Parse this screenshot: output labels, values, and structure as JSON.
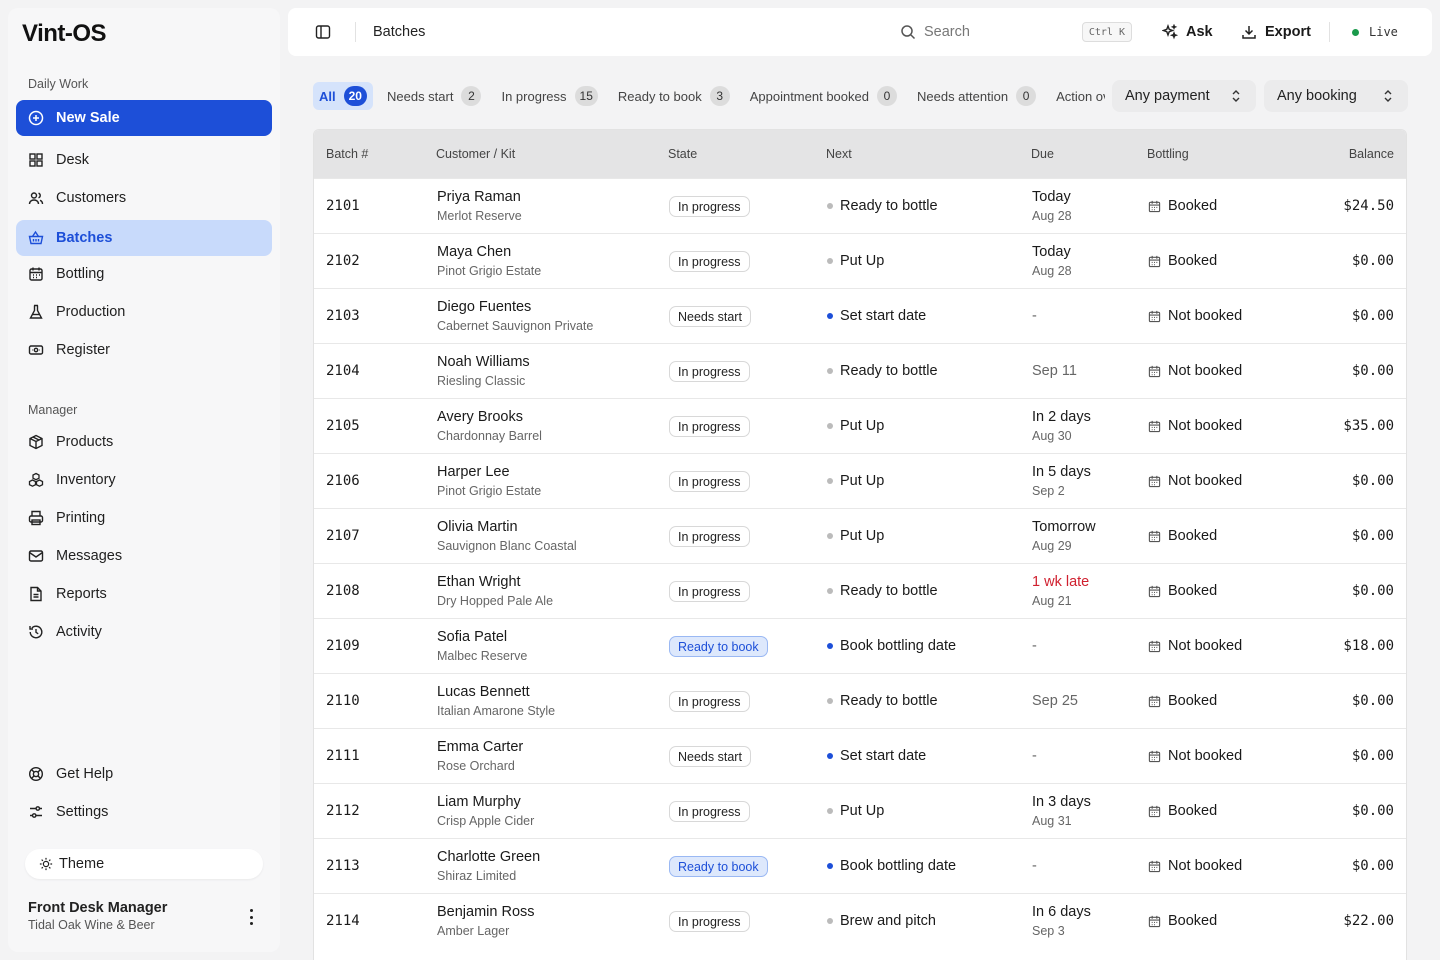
{
  "app": {
    "logo": "Vint-OS"
  },
  "sidebar": {
    "daily_work_label": "Daily Work",
    "new_sale": "New Sale",
    "daily": [
      {
        "label": "Desk",
        "icon": "grid-icon"
      },
      {
        "label": "Customers",
        "icon": "users-icon"
      },
      {
        "label": "Batches",
        "icon": "basket-icon"
      },
      {
        "label": "Bottling",
        "icon": "calendar-icon"
      },
      {
        "label": "Production",
        "icon": "flask-icon"
      },
      {
        "label": "Register",
        "icon": "cash-icon"
      }
    ],
    "manager_label": "Manager",
    "manager": [
      {
        "label": "Products",
        "icon": "box-icon"
      },
      {
        "label": "Inventory",
        "icon": "boxes-icon"
      },
      {
        "label": "Printing",
        "icon": "printer-icon"
      },
      {
        "label": "Messages",
        "icon": "mail-icon"
      },
      {
        "label": "Reports",
        "icon": "file-icon"
      },
      {
        "label": "Activity",
        "icon": "history-icon"
      }
    ],
    "footer": [
      {
        "label": "Get Help",
        "icon": "lifebuoy-icon"
      },
      {
        "label": "Settings",
        "icon": "sliders-icon"
      }
    ],
    "theme": "Theme",
    "user": {
      "name": "Front Desk Manager",
      "org": "Tidal Oak Wine & Beer"
    }
  },
  "header": {
    "title": "Batches",
    "search_placeholder": "Search",
    "shortcut": "Ctrl K",
    "ask": "Ask",
    "export": "Export",
    "live": "Live"
  },
  "filters": {
    "chips": [
      {
        "label": "All",
        "count": "20"
      },
      {
        "label": "Needs start",
        "count": "2"
      },
      {
        "label": "In progress",
        "count": "15"
      },
      {
        "label": "Ready to book",
        "count": "3"
      },
      {
        "label": "Appointment booked",
        "count": "0"
      },
      {
        "label": "Needs attention",
        "count": "0"
      },
      {
        "label": "Action overdue",
        "count": ""
      }
    ],
    "payment": "Any payment",
    "booking": "Any booking"
  },
  "table": {
    "columns": [
      "Batch #",
      "Customer / Kit",
      "State",
      "Next",
      "Due",
      "Bottling",
      "Balance"
    ],
    "rows": [
      {
        "id": "2101",
        "name": "Priya Raman",
        "kit": "Merlot Reserve",
        "state": "In progress",
        "next": "Ready to bottle",
        "due": "Today",
        "due_date": "Aug 28",
        "bottling": "Booked",
        "balance": "$24.50"
      },
      {
        "id": "2102",
        "name": "Maya Chen",
        "kit": "Pinot Grigio Estate",
        "state": "In progress",
        "next": "Put Up",
        "due": "Today",
        "due_date": "Aug 28",
        "bottling": "Booked",
        "balance": "$0.00"
      },
      {
        "id": "2103",
        "name": "Diego Fuentes",
        "kit": "Cabernet Sauvignon Private",
        "state": "Needs start",
        "next": "Set start date",
        "due": "-",
        "due_date": "",
        "bottling": "Not booked",
        "balance": "$0.00"
      },
      {
        "id": "2104",
        "name": "Noah Williams",
        "kit": "Riesling Classic",
        "state": "In progress",
        "next": "Ready to bottle",
        "due": "Sep 11",
        "due_date": "",
        "bottling": "Not booked",
        "balance": "$0.00"
      },
      {
        "id": "2105",
        "name": "Avery Brooks",
        "kit": "Chardonnay Barrel",
        "state": "In progress",
        "next": "Put Up",
        "due": "In 2 days",
        "due_date": "Aug 30",
        "bottling": "Not booked",
        "balance": "$35.00"
      },
      {
        "id": "2106",
        "name": "Harper Lee",
        "kit": "Pinot Grigio Estate",
        "state": "In progress",
        "next": "Put Up",
        "due": "In 5 days",
        "due_date": "Sep 2",
        "bottling": "Not booked",
        "balance": "$0.00"
      },
      {
        "id": "2107",
        "name": "Olivia Martin",
        "kit": "Sauvignon Blanc Coastal",
        "state": "In progress",
        "next": "Put Up",
        "due": "Tomorrow",
        "due_date": "Aug 29",
        "bottling": "Booked",
        "balance": "$0.00"
      },
      {
        "id": "2108",
        "name": "Ethan Wright",
        "kit": "Dry Hopped Pale Ale",
        "state": "In progress",
        "next": "Ready to bottle",
        "due": "1 wk late",
        "due_date": "Aug 21",
        "bottling": "Booked",
        "balance": "$0.00",
        "late": true
      },
      {
        "id": "2109",
        "name": "Sofia Patel",
        "kit": "Malbec Reserve",
        "state": "Ready to book",
        "next": "Book bottling date",
        "due": "-",
        "due_date": "",
        "bottling": "Not booked",
        "balance": "$18.00"
      },
      {
        "id": "2110",
        "name": "Lucas Bennett",
        "kit": "Italian Amarone Style",
        "state": "In progress",
        "next": "Ready to bottle",
        "due": "Sep 25",
        "due_date": "",
        "bottling": "Booked",
        "balance": "$0.00"
      },
      {
        "id": "2111",
        "name": "Emma Carter",
        "kit": "Rose Orchard",
        "state": "Needs start",
        "next": "Set start date",
        "due": "-",
        "due_date": "",
        "bottling": "Not booked",
        "balance": "$0.00"
      },
      {
        "id": "2112",
        "name": "Liam Murphy",
        "kit": "Crisp Apple Cider",
        "state": "In progress",
        "next": "Put Up",
        "due": "In 3 days",
        "due_date": "Aug 31",
        "bottling": "Booked",
        "balance": "$0.00"
      },
      {
        "id": "2113",
        "name": "Charlotte Green",
        "kit": "Shiraz Limited",
        "state": "Ready to book",
        "next": "Book bottling date",
        "due": "-",
        "due_date": "",
        "bottling": "Not booked",
        "balance": "$0.00"
      },
      {
        "id": "2114",
        "name": "Benjamin Ross",
        "kit": "Amber Lager",
        "state": "In progress",
        "next": "Brew and pitch",
        "due": "In 6 days",
        "due_date": "Sep 3",
        "bottling": "Booked",
        "balance": "$22.00"
      }
    ]
  },
  "colors": {
    "accent": "#1d4fd8",
    "active_bg": "#c8dafb",
    "late": "#d0202f",
    "live": "#1a9a4b"
  }
}
